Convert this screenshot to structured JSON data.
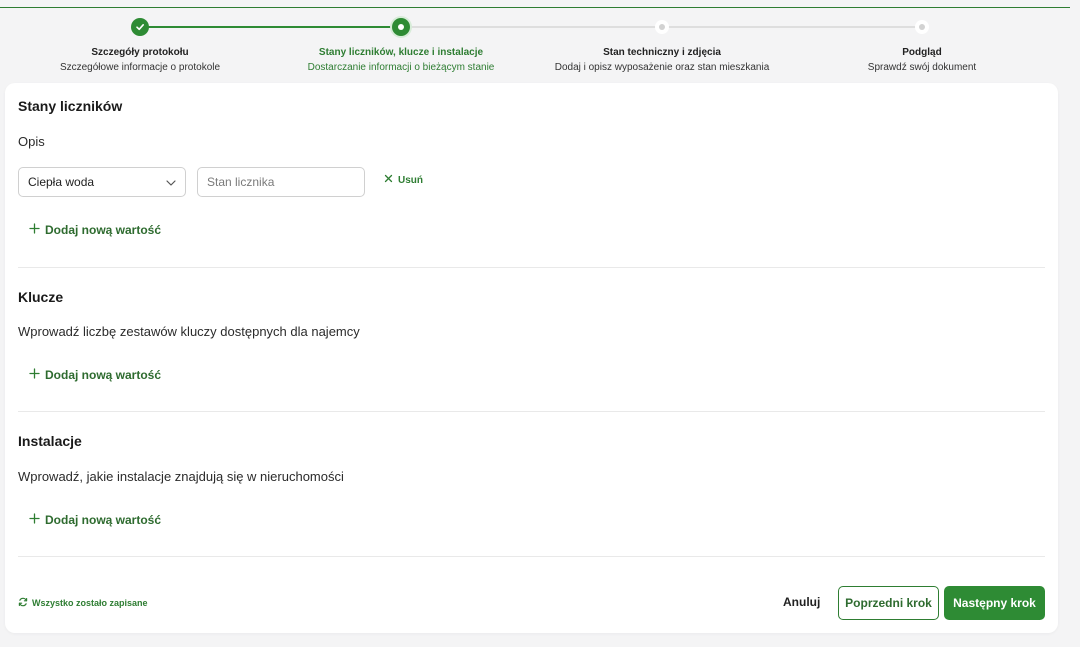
{
  "stepper": {
    "steps": [
      {
        "title": "Szczegóły protokołu",
        "subtitle": "Szczegółowe informacje o protokole",
        "state": "done"
      },
      {
        "title": "Stany liczników, klucze i instalacje",
        "subtitle": "Dostarczanie informacji o bieżącym stanie",
        "state": "current"
      },
      {
        "title": "Stan techniczny i zdjęcia",
        "subtitle": "Dodaj i opisz wyposażenie oraz stan mieszkania",
        "state": "todo"
      },
      {
        "title": "Podgląd",
        "subtitle": "Sprawdź swój dokument",
        "state": "todo"
      }
    ]
  },
  "meters": {
    "title": "Stany liczników",
    "description": "Opis",
    "rows": [
      {
        "type_value": "Ciepła woda",
        "reading_placeholder": "Stan licznika",
        "remove_label": "Usuń"
      }
    ],
    "add_label": "Dodaj nową wartość"
  },
  "keys": {
    "title": "Klucze",
    "description": "Wprowadź liczbę zestawów kluczy dostępnych dla najemcy",
    "add_label": "Dodaj nową wartość"
  },
  "installations": {
    "title": "Instalacje",
    "description": "Wprowadź, jakie instalacje znajdują się w nieruchomości",
    "add_label": "Dodaj nową wartość"
  },
  "footer": {
    "save_status": "Wszystko zostało zapisane",
    "cancel_label": "Anuluj",
    "prev_label": "Poprzedni krok",
    "next_label": "Następny krok"
  },
  "colors": {
    "accent": "#2e8b34",
    "accent_text": "#2e7d32",
    "inactive_track": "#dedede"
  }
}
